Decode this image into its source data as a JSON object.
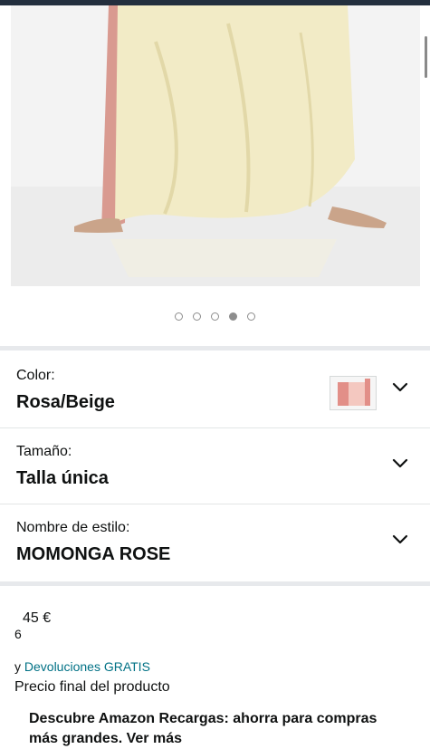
{
  "carousel": {
    "count": 5,
    "active_index": 3
  },
  "variants": {
    "color": {
      "label": "Color:",
      "value": "Rosa/Beige"
    },
    "size": {
      "label": "Tamaño:",
      "value": "Talla única"
    },
    "style": {
      "label": "Nombre de estilo:",
      "value": "MOMONGA ROSE"
    }
  },
  "pricing": {
    "price": "45 €",
    "price_sub": "6",
    "returns_prefix": "y",
    "returns_link": "Devoluciones GRATIS",
    "final_price_note": "Precio final del producto"
  },
  "promo": {
    "text": "Descubre Amazon Recargas: ahorra para compras más grandes. Ver más"
  },
  "colors": {
    "link": "#007185",
    "divider": "#e7e9ec",
    "header": "#232f3e"
  }
}
